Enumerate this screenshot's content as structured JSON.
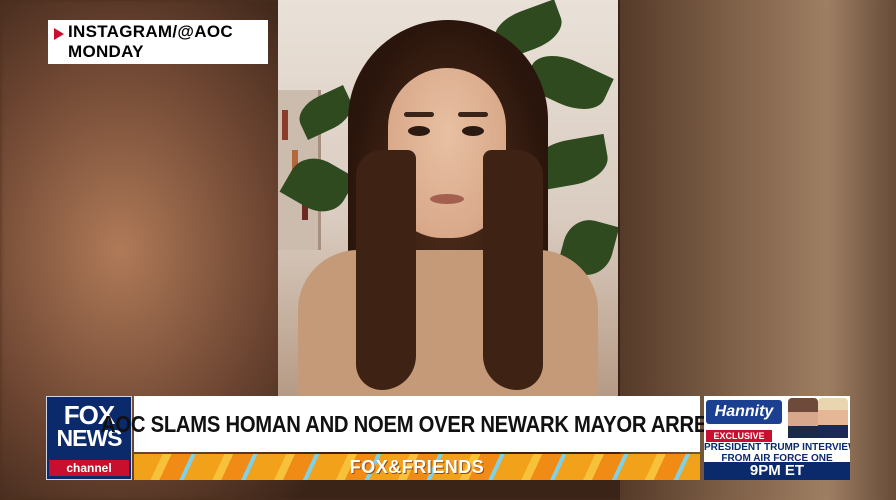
{
  "source_tag": {
    "line1": "INSTAGRAM/@AOC",
    "line2": "MONDAY"
  },
  "network_logo": {
    "line1": "FOX",
    "line2": "NEWS",
    "line3": "channel"
  },
  "headline": "AOC SLAMS HOMAN AND NOEM OVER NEWARK MAYOR ARREST",
  "show_name": "FOX&FRIENDS",
  "promo": {
    "brand": "Hannity",
    "badge": "EXCLUSIVE",
    "line1": "PRESIDENT TRUMP INTERVIEW",
    "line2": "FROM AIR FORCE ONE",
    "time": "9PM ET"
  },
  "colors": {
    "fox_blue": "#0a2a6b",
    "fox_red": "#c8102e",
    "friends_orange": "#f1a21a"
  }
}
